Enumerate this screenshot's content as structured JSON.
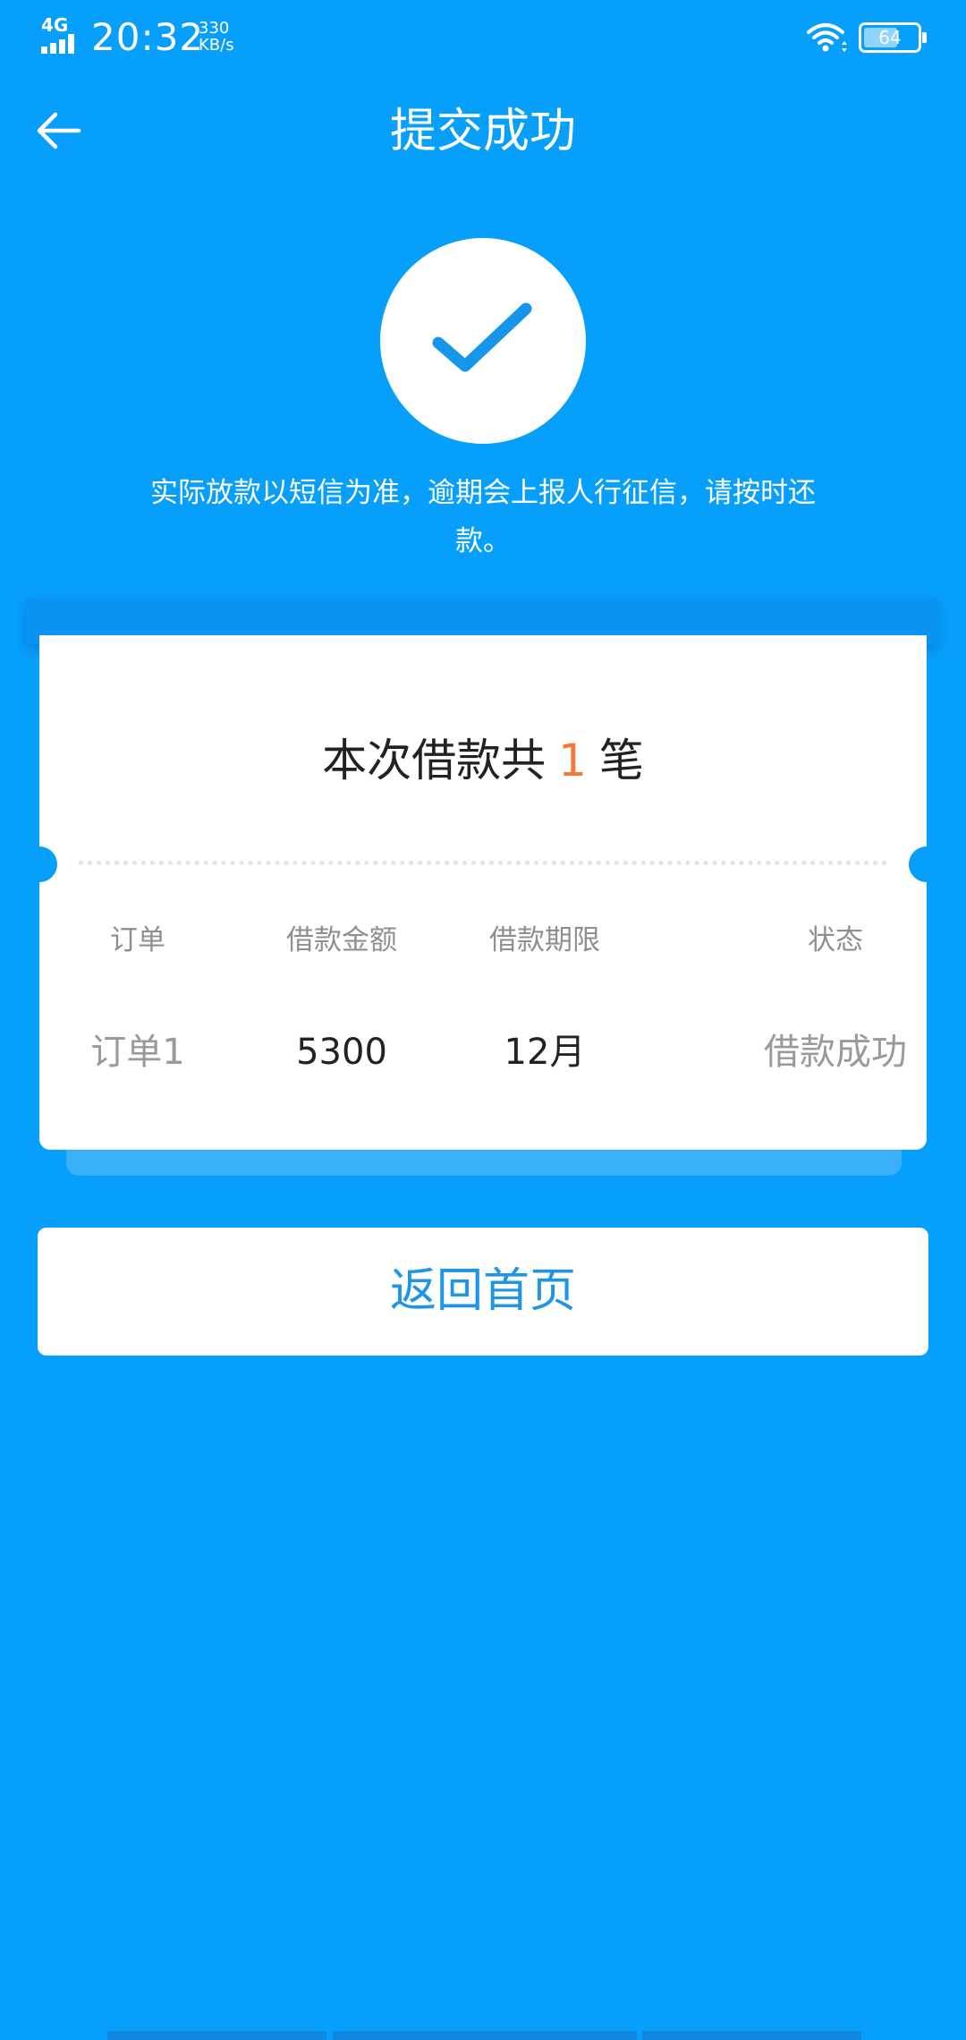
{
  "status_bar": {
    "network": "4G",
    "time": "20:32",
    "speed_value": "330",
    "speed_unit": "KB/s",
    "battery": "64",
    "battery_level": 0.64
  },
  "header": {
    "back_icon": "arrow-left-icon",
    "title": "提交成功"
  },
  "success": {
    "icon": "checkmark-icon",
    "notice": "实际放款以短信为准，逾期会上报人行征信，请按时还款。"
  },
  "card": {
    "heading_prefix": "本次借款共",
    "count": "1",
    "heading_suffix": "笔",
    "columns": [
      "订单",
      "借款金额",
      "借款期限",
      "状态"
    ],
    "rows": [
      [
        "订单1",
        "5300",
        "12月",
        "借款成功"
      ]
    ]
  },
  "home_button": {
    "label": "返回首页"
  },
  "colors": {
    "background": "#079FFC",
    "accent_text": "#1E95E6",
    "count_highlight": "#F47A3A"
  }
}
